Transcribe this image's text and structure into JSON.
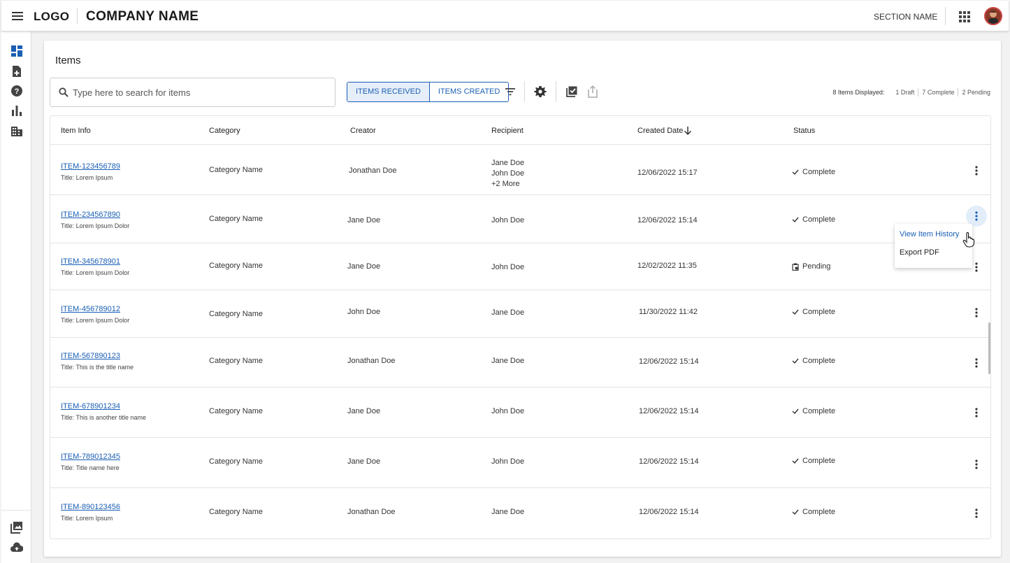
{
  "header": {
    "logo": "LOGO",
    "company": "COMPANY NAME",
    "section": "SECTION NAME",
    "icons": [
      "hamburger-menu-icon",
      "apps-grid-icon",
      "user-avatar"
    ]
  },
  "rail": {
    "icons": [
      "dashboard-icon",
      "new-document-icon",
      "help-icon",
      "bar-chart-icon",
      "building-icon",
      "photo-library-icon",
      "cloud-upload-icon"
    ],
    "active_color": "#1a5fb4"
  },
  "main": {
    "title": "Items",
    "search_placeholder": "Type here to search for items",
    "toggle": {
      "received": "ITEMS RECEIVED",
      "created": "ITEMS CREATED",
      "active": "received"
    },
    "tools": [
      "filter-icon",
      "settings-gear-icon",
      "select-all-checkbox-icon",
      "share-export-icon"
    ],
    "summary": {
      "label": "8 Items Displayed:",
      "draft": "1 Draft",
      "complete": "7 Complete",
      "pending": "2 Pending"
    }
  },
  "table": {
    "columns": [
      "Item Info",
      "Category",
      "Creator",
      "Recipient",
      "Created Date",
      "Status"
    ],
    "sort_column": "Created Date",
    "rows": [
      {
        "id": "ITEM-123456789",
        "title": "Title: Lorem Ipsum",
        "category": "Category Name",
        "creator": "Jonathan Doe",
        "recipient": "Jane Doe",
        "recipient2": "John Doe",
        "recipient_more": "+2 More",
        "date": "12/06/2022 15:17",
        "status": "Complete"
      },
      {
        "id": "ITEM-234567890",
        "title": "Title: Lorem Ipsum Dolor",
        "category": "Category Name",
        "creator": "Jane Doe",
        "recipient": "John Doe",
        "date": "12/06/2022 15:14",
        "status": "Complete"
      },
      {
        "id": "ITEM-345678901",
        "title": "Title: Lorem Ipsum Dolor",
        "category": "Category Name",
        "creator": "Jane Doe",
        "recipient": "John Doe",
        "date": "12/02/2022 11:35",
        "status": "Pending"
      },
      {
        "id": "ITEM-456789012",
        "title": "Title: Lorem Ipsum Dolor",
        "category": "Category Name",
        "creator": "John Doe",
        "recipient": "Jane Doe",
        "date": "11/30/2022 11:42",
        "status": "Complete"
      },
      {
        "id": "ITEM-567890123",
        "title": "Title: This is the title name",
        "category": "Category Name",
        "creator": "Jonathan Doe",
        "recipient": "Jane Doe",
        "date": "12/06/2022 15:14",
        "status": "Complete"
      },
      {
        "id": "ITEM-678901234",
        "title": "Title: This is another title name",
        "category": "Category Name",
        "creator": "Jane Doe",
        "recipient": "John Doe",
        "date": "12/06/2022 15:14",
        "status": "Complete"
      },
      {
        "id": "ITEM-789012345",
        "title": "Title: Title name here",
        "category": "Category Name",
        "creator": "Jane Doe",
        "recipient": "John Doe",
        "date": "12/06/2022 15:14",
        "status": "Complete"
      },
      {
        "id": "ITEM-890123456",
        "title": "Title: Lorem Ipsum",
        "category": "Category Name",
        "creator": "Jonathan Doe",
        "recipient": "Jane Doe",
        "date": "12/06/2022 15:14",
        "status": "Complete"
      }
    ]
  },
  "dropdown": {
    "items": [
      "View Item History",
      "Export PDF"
    ],
    "open_on_row": "ITEM-234567890"
  }
}
